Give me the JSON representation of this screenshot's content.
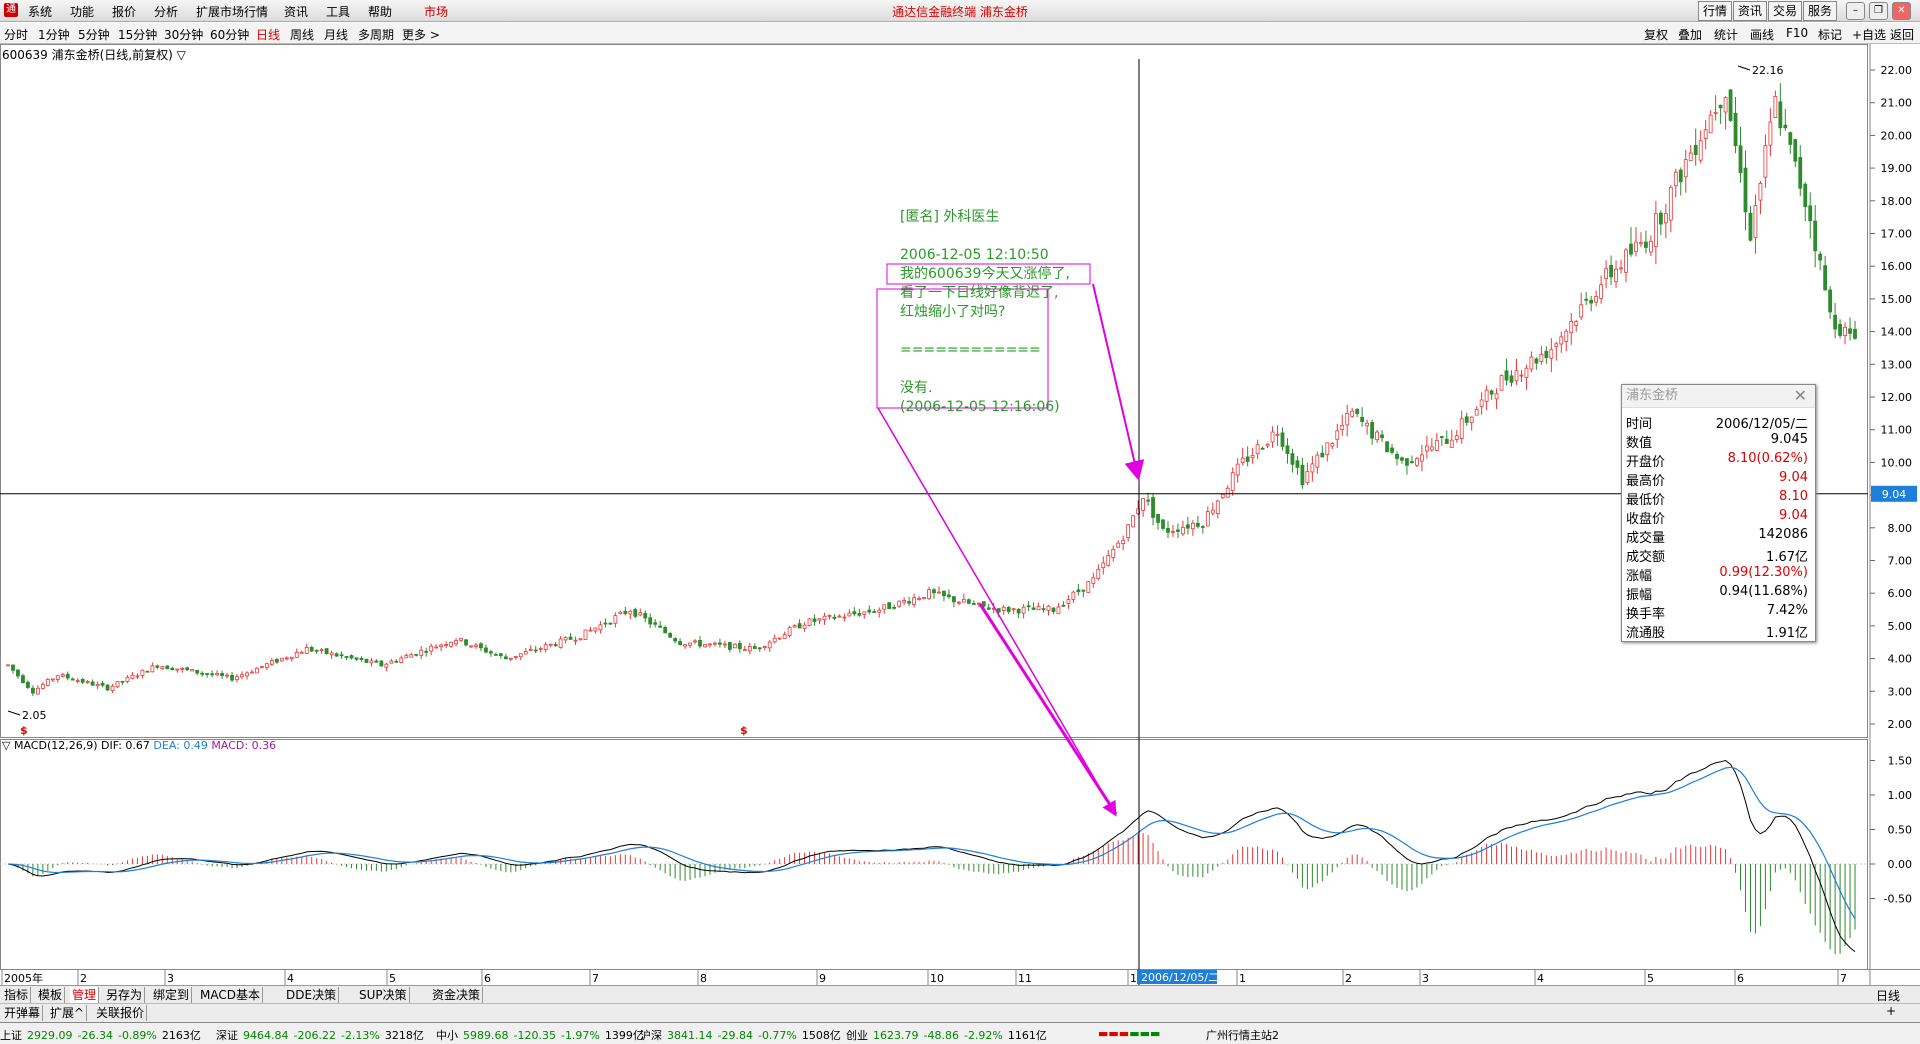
{
  "app": {
    "title": "通达信金融终端 浦东金桥"
  },
  "menu": {
    "items": [
      "系统",
      "功能",
      "报价",
      "分析",
      "扩展市场行情",
      "资讯",
      "工具",
      "帮助",
      "市场"
    ]
  },
  "topright": [
    "行情",
    "资讯",
    "交易",
    "服务"
  ],
  "period": {
    "items": [
      "分时",
      "1分钟",
      "5分钟",
      "15分钟",
      "30分钟",
      "60分钟",
      "日线",
      "周线",
      "月线",
      "多周期",
      "更多 >"
    ],
    "selected": "日线",
    "right": [
      "复权",
      "叠加",
      "统计",
      "画线",
      "F10",
      "标记",
      "+自选",
      "返回"
    ]
  },
  "chart_info": "600639 浦东金桥(日线,前复权) ▽",
  "chart_data": {
    "type": "candlestick",
    "title": "600639 浦东金桥(日线,前复权)",
    "y_ticks": [
      22.0,
      21.0,
      20.0,
      19.0,
      18.0,
      17.0,
      16.0,
      15.0,
      14.0,
      13.0,
      12.0,
      11.0,
      10.0,
      9.0,
      8.0,
      7.0,
      6.0,
      5.0,
      4.0,
      3.0,
      2.0
    ],
    "x_months": [
      "2005年",
      "2",
      "3",
      "4",
      "5",
      "6",
      "7",
      "8",
      "9",
      "10",
      "11",
      "1",
      "1",
      "2",
      "3",
      "4",
      "5",
      "6",
      "7"
    ],
    "cursor_date": "2006/12/05/二",
    "cursor_price": "9.04",
    "max_label": "22.16",
    "min_label": "2.05",
    "price_path_approx": [
      [
        0,
        3.8
      ],
      [
        5,
        3.0
      ],
      [
        10,
        3.5
      ],
      [
        20,
        3.1
      ],
      [
        30,
        3.8
      ],
      [
        45,
        3.4
      ],
      [
        60,
        4.3
      ],
      [
        75,
        3.8
      ],
      [
        90,
        4.6
      ],
      [
        100,
        4.0
      ],
      [
        115,
        4.7
      ],
      [
        125,
        5.5
      ],
      [
        135,
        4.5
      ],
      [
        150,
        4.3
      ],
      [
        160,
        5.1
      ],
      [
        175,
        5.5
      ],
      [
        185,
        6.0
      ],
      [
        195,
        5.6
      ],
      [
        200,
        5.5
      ],
      [
        210,
        5.5
      ],
      [
        218,
        6.4
      ],
      [
        225,
        8.0
      ],
      [
        228,
        9.0
      ],
      [
        232,
        7.9
      ],
      [
        240,
        8.2
      ],
      [
        248,
        10.0
      ],
      [
        255,
        11.0
      ],
      [
        260,
        9.5
      ],
      [
        270,
        11.5
      ],
      [
        280,
        10.0
      ],
      [
        290,
        10.8
      ],
      [
        300,
        12.5
      ],
      [
        310,
        13.5
      ],
      [
        320,
        15.5
      ],
      [
        330,
        17.0
      ],
      [
        338,
        19.5
      ],
      [
        345,
        21.5
      ],
      [
        350,
        17.0
      ],
      [
        355,
        21.0
      ],
      [
        362,
        17.5
      ],
      [
        366,
        14.5
      ],
      [
        370,
        13.8
      ]
    ],
    "macd": {
      "label": "MACD(12,26,9)",
      "dif_label": "DIF:",
      "dif": 0.67,
      "dea_label": "DEA:",
      "dea": 0.49,
      "macd_label": "MACD:",
      "macd": 0.36,
      "y_ticks": [
        1.5,
        1.0,
        0.5,
        0.0,
        -0.5
      ]
    },
    "colors": {
      "up": "#e8393a",
      "down": "#2e8b2e",
      "dif": "#000000",
      "dea": "#1e7fd8",
      "macd": "#a01aa0"
    }
  },
  "note": {
    "lines": [
      "[匿名] 外科医生",
      "",
      "2006-12-05 12:10:50",
      "我的600639今天又涨停了,",
      "看了一下日线好像背迟了,",
      "红烛缩小了对吗?",
      "",
      "============",
      "",
      "没有.",
      "(2006-12-05 12:16:06)"
    ]
  },
  "popup": {
    "title": "浦东金桥",
    "rows": [
      {
        "k": "时间",
        "v": "2006/12/05/二",
        "c": "ig"
      },
      {
        "k": "数值",
        "v": "9.045",
        "c": "ig"
      },
      {
        "k": "开盘价",
        "v": "8.10(0.62%)",
        "c": "up"
      },
      {
        "k": "最高价",
        "v": "9.04",
        "c": "up"
      },
      {
        "k": "最低价",
        "v": "8.10",
        "c": "up"
      },
      {
        "k": "收盘价",
        "v": "9.04",
        "c": "up"
      },
      {
        "k": "成交量",
        "v": "142086",
        "c": "ig"
      },
      {
        "k": "成交额",
        "v": "1.67亿",
        "c": "ig"
      },
      {
        "k": "涨幅",
        "v": "0.99(12.30%)",
        "c": "up"
      },
      {
        "k": "振幅",
        "v": "0.94(11.68%)",
        "c": "ig"
      },
      {
        "k": "换手率",
        "v": "7.42%",
        "c": "ig"
      },
      {
        "k": "流通股",
        "v": "1.91亿",
        "c": "ig"
      }
    ]
  },
  "tabs1": [
    "指标",
    "模板",
    "管理",
    "另存为",
    "绑定到",
    "MACD基本",
    "DDE决策",
    "SUP决策",
    "资金决策"
  ],
  "tabs1_selected": "管理",
  "tabs1_right": "日线",
  "tabs2": [
    "开弹幕",
    "扩展^",
    "关联报价"
  ],
  "status": {
    "items": [
      {
        "name": "上证",
        "val": "2929.09",
        "chg": "-26.34",
        "pct": "-0.89%",
        "amt": "2163亿"
      },
      {
        "name": "深证",
        "val": "9464.84",
        "chg": "-206.22",
        "pct": "-2.13%",
        "amt": "3218亿"
      },
      {
        "name": "中小",
        "val": "5989.68",
        "chg": "-120.35",
        "pct": "-1.97%",
        "amt": "1399亿"
      },
      {
        "name": "沪深",
        "val": "3841.14",
        "chg": "-29.84",
        "pct": "-0.77%",
        "amt": "1508亿"
      },
      {
        "name": "创业",
        "val": "1623.79",
        "chg": "-48.86",
        "pct": "-2.92%",
        "amt": "1161亿"
      }
    ],
    "server": "广州行情主站2"
  }
}
